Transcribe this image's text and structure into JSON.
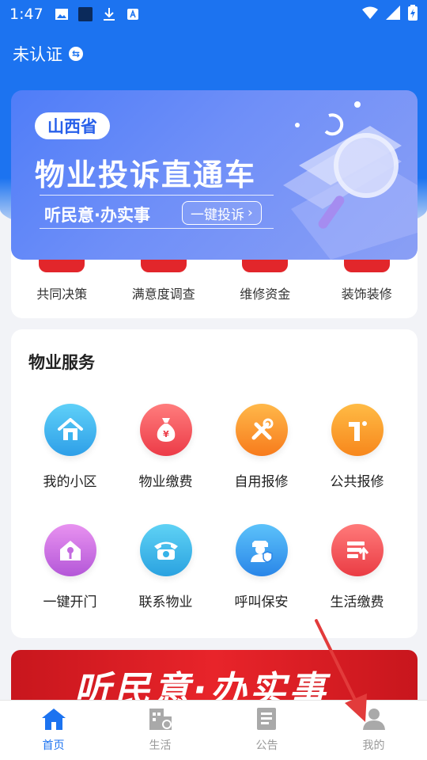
{
  "status_bar": {
    "time": "1:47"
  },
  "header": {
    "auth_status": "未认证",
    "swap_icon": "⇆"
  },
  "banner": {
    "tag": "山西省",
    "title": "物业投诉直通车",
    "subtitle": "听民意·办实事",
    "button_label": "一键投诉"
  },
  "quick_actions": [
    {
      "label": "共同决策",
      "icon": "decision-icon"
    },
    {
      "label": "满意度调查",
      "icon": "survey-icon"
    },
    {
      "label": "维修资金",
      "icon": "fund-icon"
    },
    {
      "label": "装饰装修",
      "icon": "decoration-icon"
    }
  ],
  "services": {
    "title": "物业服务",
    "items": [
      {
        "label": "我的小区",
        "icon": "home-icon",
        "color": "#3ab4f0"
      },
      {
        "label": "物业缴费",
        "icon": "money-bag-icon",
        "color": "#f0505a"
      },
      {
        "label": "自用报修",
        "icon": "tools-icon",
        "color": "#f8922e"
      },
      {
        "label": "公共报修",
        "icon": "public-repair-icon",
        "color": "#f8952a"
      },
      {
        "label": "一键开门",
        "icon": "house-key-icon",
        "color": "#cc6ee0"
      },
      {
        "label": "联系物业",
        "icon": "telephone-icon",
        "color": "#35b3e8"
      },
      {
        "label": "呼叫保安",
        "icon": "security-guard-icon",
        "color": "#3aa0ee"
      },
      {
        "label": "生活缴费",
        "icon": "bill-payment-icon",
        "color": "#f05555"
      }
    ]
  },
  "promo_banner": {
    "text": "听民意·办实事"
  },
  "tabbar": {
    "tabs": [
      {
        "label": "首页",
        "icon": "home-tab-icon",
        "active": true
      },
      {
        "label": "生活",
        "icon": "life-tab-icon",
        "active": false
      },
      {
        "label": "公告",
        "icon": "notice-tab-icon",
        "active": false
      },
      {
        "label": "我的",
        "icon": "profile-tab-icon",
        "active": false
      }
    ]
  },
  "colors": {
    "primary": "#1c73f0",
    "quick_icon": "#e2262b",
    "annotation_arrow": "#e23b3b"
  }
}
